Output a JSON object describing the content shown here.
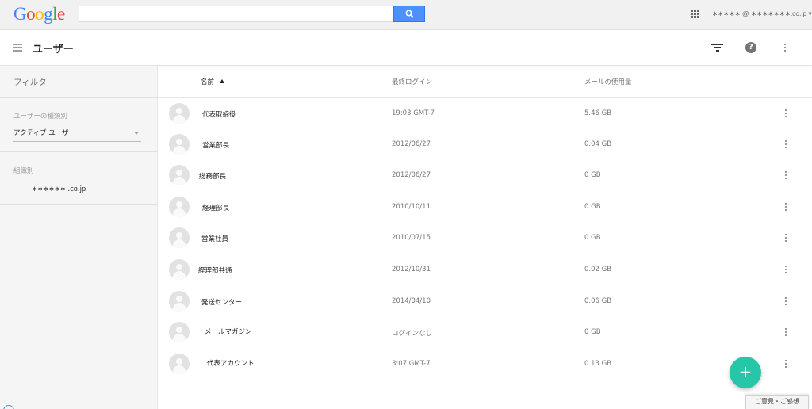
{
  "google_bar": {
    "logo_letters": [
      {
        "ch": "G",
        "color": "#4285f4"
      },
      {
        "ch": "o",
        "color": "#ea4335"
      },
      {
        "ch": "o",
        "color": "#fbbc05"
      },
      {
        "ch": "g",
        "color": "#4285f4"
      },
      {
        "ch": "l",
        "color": "#34a853"
      },
      {
        "ch": "e",
        "color": "#ea4335"
      }
    ],
    "search_value": "",
    "account_label": "∗∗∗∗∗ @ ∗∗∗∗∗∗∗.co.jp ▾"
  },
  "header": {
    "title": "ユーザー",
    "help_glyph": "?"
  },
  "sidebar": {
    "filter_title": "フィルタ",
    "user_type_label": "ユーザーの種類別",
    "user_type_value": "アクティブ ユーザー",
    "org_label": "組織別",
    "org_value": "∗∗∗∗∗∗ .co.jp"
  },
  "table": {
    "columns": {
      "name": "名前",
      "last_login": "最終ログイン",
      "mail_usage": "メールの使用量"
    },
    "rows": [
      {
        "name": "代表取締役",
        "last_login": "19:03 GMT-7",
        "mail_usage": "5.46 GB"
      },
      {
        "name": "営業部長",
        "last_login": "2012/06/27",
        "mail_usage": "0.04 GB"
      },
      {
        "name": "総務部長",
        "last_login": "2012/06/27",
        "mail_usage": "0 GB"
      },
      {
        "name": "経理部長",
        "last_login": "2010/10/11",
        "mail_usage": "0 GB"
      },
      {
        "name": "営業社員",
        "last_login": "2010/07/15",
        "mail_usage": "0 GB"
      },
      {
        "name": "経理部共通",
        "last_login": "2012/10/31",
        "mail_usage": "0.02 GB"
      },
      {
        "name": "発送センター",
        "last_login": "2014/04/10",
        "mail_usage": "0.06 GB"
      },
      {
        "name": "メールマガジン",
        "last_login": "ログインなし",
        "mail_usage": "0 GB"
      },
      {
        "name": "代表アカウント",
        "last_login": "3:07 GMT-7",
        "mail_usage": "0.13 GB"
      }
    ]
  },
  "fab": {
    "glyph": "+"
  },
  "feedback": {
    "label": "ご意見・ご感想"
  }
}
